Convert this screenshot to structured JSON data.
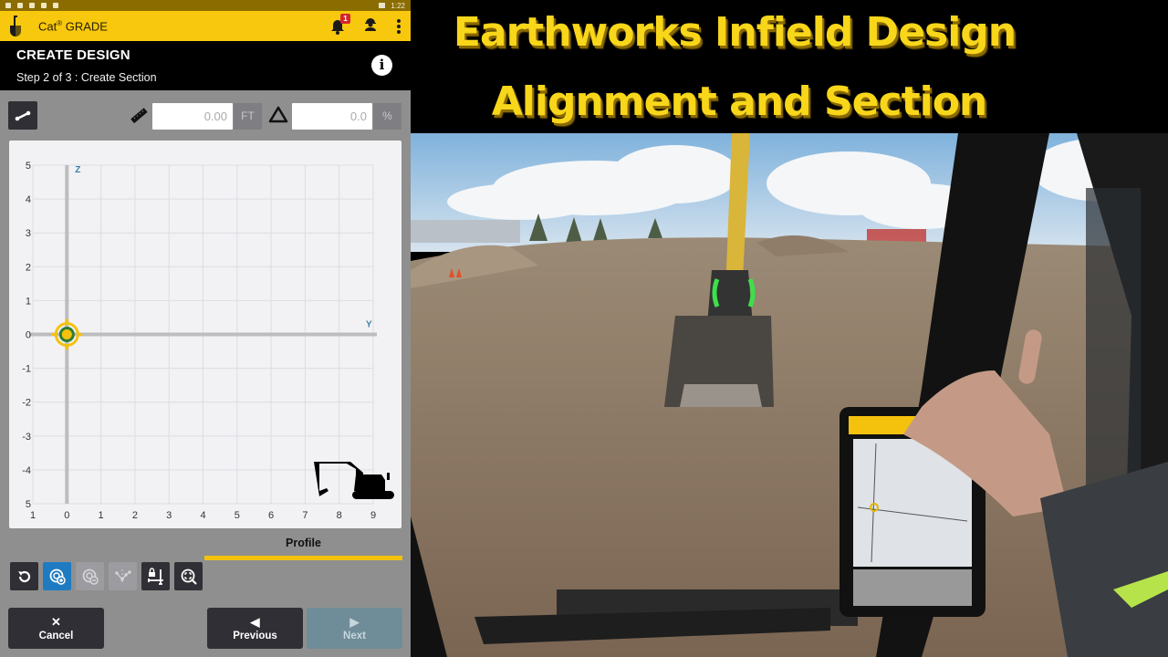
{
  "status_bar": {
    "time": "1:22"
  },
  "app_bar": {
    "title": "Cat",
    "registered": "®",
    "title_suffix": " GRADE",
    "notification_count": "1",
    "icons": [
      "shovel-logo-icon",
      "bell-icon",
      "operator-icon",
      "more-vert-icon"
    ]
  },
  "header": {
    "title": "CREATE DESIGN",
    "subtitle": "Step 2 of 3 : Create Section",
    "info_icon": "i"
  },
  "inputs": {
    "distance": {
      "value": "0.00",
      "unit": "FT"
    },
    "slope": {
      "value": "0.0",
      "unit": "%"
    }
  },
  "chart_data": {
    "type": "scatter",
    "title": "",
    "xlabel": "Y",
    "ylabel": "Z",
    "x_ticks": [
      "1",
      "0",
      "1",
      "2",
      "3",
      "4",
      "5",
      "6",
      "7",
      "8",
      "9"
    ],
    "y_ticks": [
      "5",
      "4",
      "3",
      "2",
      "1",
      "0",
      "-1",
      "-2",
      "-3",
      "-4",
      "5"
    ],
    "xlim": [
      -1,
      9
    ],
    "ylim": [
      -5,
      5
    ],
    "grid": true,
    "points": [
      {
        "x": 0,
        "z": 0,
        "label": "origin",
        "selected": true
      }
    ]
  },
  "tab": {
    "label": "Profile"
  },
  "toolbar_icons": [
    {
      "name": "reset-icon",
      "state": "normal"
    },
    {
      "name": "add-point-icon",
      "state": "active"
    },
    {
      "name": "remove-point-icon",
      "state": "disabled"
    },
    {
      "name": "edit-points-icon",
      "state": "disabled"
    },
    {
      "name": "lock-extents-icon",
      "state": "normal"
    },
    {
      "name": "zoom-fit-icon",
      "state": "normal"
    }
  ],
  "buttons": {
    "cancel": {
      "label": "Cancel",
      "glyph": "✕"
    },
    "previous": {
      "label": "Previous",
      "glyph": "◀"
    },
    "next": {
      "label": "Next",
      "glyph": "▶"
    }
  },
  "video": {
    "title_line1": "Earthworks Infield Design",
    "title_line2": "Alignment and Section"
  }
}
